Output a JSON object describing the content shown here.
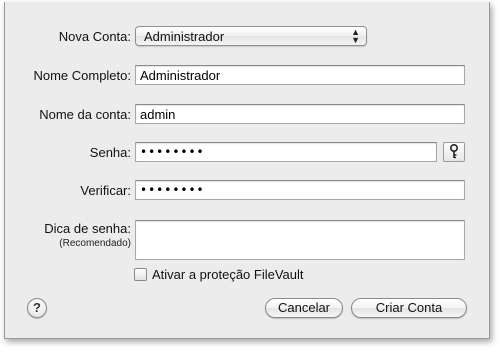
{
  "form": {
    "new_account": {
      "label": "Nova Conta:",
      "selected": "Administrador"
    },
    "full_name": {
      "label": "Nome Completo:",
      "value": "Administrador"
    },
    "account_name": {
      "label": "Nome da conta:",
      "value": "admin"
    },
    "password": {
      "label": "Senha:",
      "value": "••••••••"
    },
    "verify": {
      "label": "Verificar:",
      "value": "••••••••"
    },
    "hint": {
      "label": "Dica de senha:",
      "sublabel": "(Recomendado)",
      "value": ""
    },
    "filevault": {
      "label": "Ativar a proteção FileVault",
      "checked": false
    }
  },
  "buttons": {
    "help": "?",
    "cancel": "Cancelar",
    "create": "Criar Conta"
  },
  "icons": {
    "select_arrows": "▲▼",
    "key": "key-icon"
  }
}
